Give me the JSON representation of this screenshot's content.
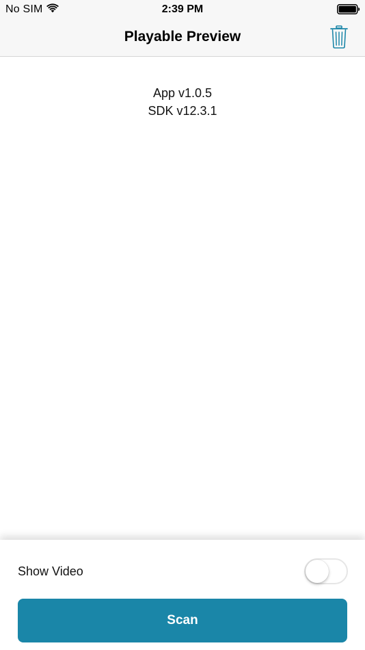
{
  "status_bar": {
    "carrier": "No SIM",
    "time": "2:39 PM",
    "wifi_icon": "wifi-icon",
    "battery_icon": "battery-icon"
  },
  "nav_bar": {
    "title": "Playable Preview",
    "trash_icon": "trash-icon"
  },
  "content": {
    "app_version": "App v1.0.5",
    "sdk_version": "SDK v12.3.1"
  },
  "bottom_panel": {
    "show_video_label": "Show Video",
    "show_video_enabled": false,
    "scan_label": "Scan"
  },
  "colors": {
    "accent": "#1a86a8",
    "nav_background": "#f7f7f7"
  }
}
